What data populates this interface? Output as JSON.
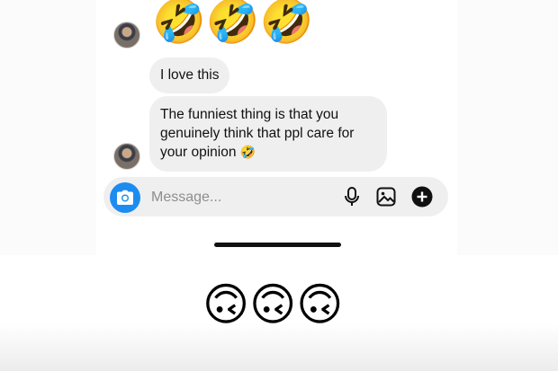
{
  "thread": {
    "reaction_emojis": "🤣🤣🤣",
    "messages": [
      {
        "text": "I love this"
      },
      {
        "text": "The funniest thing is that you genuinely think that ppl care for your opinion",
        "trailing_emoji": "🤣"
      }
    ]
  },
  "composer": {
    "placeholder": "Message...",
    "icons": [
      "camera-icon",
      "microphone-icon",
      "image-icon",
      "plus-icon"
    ],
    "accent_color": "#1d8cf0"
  },
  "reaction_below": "🙃🙃🙃"
}
